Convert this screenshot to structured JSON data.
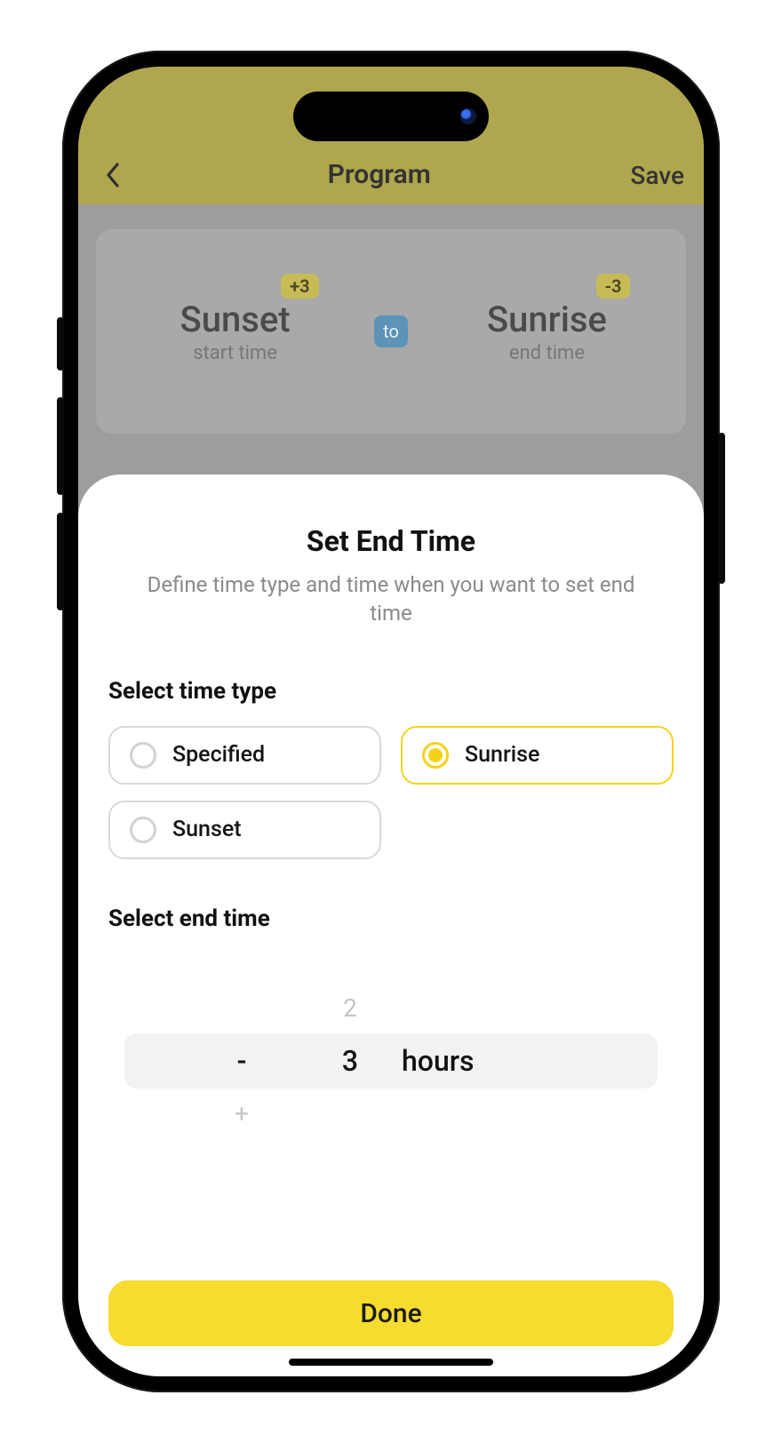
{
  "nav": {
    "title": "Program",
    "save_label": "Save"
  },
  "schedule_card": {
    "start": {
      "title": "Sunset",
      "subtitle": "start time",
      "offset_badge": "+3"
    },
    "to_label": "to",
    "end": {
      "title": "Sunrise",
      "subtitle": "end time",
      "offset_badge": "-3"
    }
  },
  "sheet": {
    "title": "Set End Time",
    "subtitle": "Define time type and time when you want to set end time",
    "time_type_label": "Select time type",
    "end_time_label": "Select end time",
    "options": {
      "specified": "Specified",
      "sunrise": "Sunrise",
      "sunset": "Sunset"
    },
    "selected_option": "sunrise",
    "picker": {
      "sign_selected": "-",
      "sign_below": "+",
      "value_above": "2",
      "value_selected": "3",
      "unit": "hours"
    },
    "done_label": "Done"
  }
}
